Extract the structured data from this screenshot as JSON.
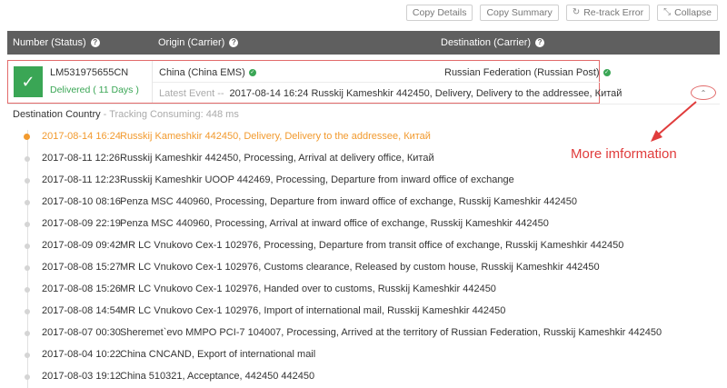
{
  "toolbar": {
    "copy_details": "Copy Details",
    "copy_summary": "Copy Summary",
    "retrack_error": "Re-track Error",
    "collapse": "Collapse"
  },
  "header": {
    "number_status": "Number (Status)",
    "origin_carrier": "Origin (Carrier)",
    "destination_carrier": "Destination (Carrier)"
  },
  "summary": {
    "tracking_number": "LM531975655CN",
    "status": "Delivered ( 11 Days )",
    "origin": "China (China EMS)",
    "destination": "Russian Federation (Russian Post)",
    "latest_event_label": "Latest Event --",
    "latest_event": "2017-08-14 16:24 Russkij Kameshkir 442450, Delivery, Delivery to the addressee, Китай"
  },
  "annotation": "More imformation",
  "destination_country": {
    "label": "Destination Country",
    "consuming": "- Tracking Consuming: 448 ms"
  },
  "events": [
    {
      "time": "2017-08-14 16:24",
      "desc": "Russkij Kameshkir 442450, Delivery, Delivery to the addressee, Китай"
    },
    {
      "time": "2017-08-11 12:26",
      "desc": "Russkij Kameshkir 442450, Processing, Arrival at delivery office, Китай"
    },
    {
      "time": "2017-08-11 12:23",
      "desc": "Russkij Kameshkir UOOP 442469, Processing, Departure from inward office of exchange"
    },
    {
      "time": "2017-08-10 08:16",
      "desc": "Penza MSC 440960, Processing, Departure from inward office of exchange, Russkij Kameshkir 442450"
    },
    {
      "time": "2017-08-09 22:19",
      "desc": "Penza MSC 440960, Processing, Arrival at inward office of exchange, Russkij Kameshkir 442450"
    },
    {
      "time": "2017-08-09 09:42",
      "desc": "MR LC Vnukovo Cex-1 102976, Processing, Departure from transit office of exchange, Russkij Kameshkir 442450"
    },
    {
      "time": "2017-08-08 15:27",
      "desc": "MR LC Vnukovo Cex-1 102976, Customs clearance, Released by custom house, Russkij Kameshkir 442450"
    },
    {
      "time": "2017-08-08 15:26",
      "desc": "MR LC Vnukovo Cex-1 102976, Handed over to customs, Russkij Kameshkir 442450"
    },
    {
      "time": "2017-08-08 14:54",
      "desc": "MR LC Vnukovo Cex-1 102976, Import of international mail, Russkij Kameshkir 442450"
    },
    {
      "time": "2017-08-07 00:30",
      "desc": "Sheremet`evo MMPO PCI-7 104007, Processing, Arrived at the territory of Russian Federation, Russkij Kameshkir 442450"
    },
    {
      "time": "2017-08-04 10:22",
      "desc": "China CNCAND, Export of international mail"
    },
    {
      "time": "2017-08-03 19:12",
      "desc": "China 510321, Acceptance, 442450 442450"
    }
  ],
  "colors": {
    "delivered_green": "#3aa655",
    "current_event_orange": "#f29a2e",
    "header_gray": "#5f5f5f",
    "annotation_red": "#e03c3c"
  }
}
